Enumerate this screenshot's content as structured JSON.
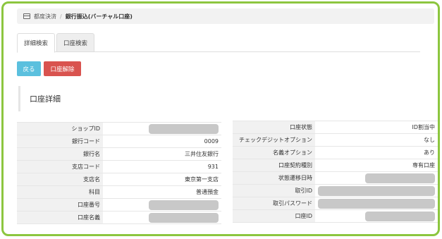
{
  "breadcrumb": {
    "parent": "都度決済",
    "separator": "/",
    "current": "銀行振込(バーチャル口座)"
  },
  "tabs": [
    {
      "label": "詳細検索",
      "active": true
    },
    {
      "label": "口座検索",
      "active": false
    }
  ],
  "buttons": {
    "back": "戻る",
    "release": "口座解除"
  },
  "section_title": "口座詳細",
  "left_rows": [
    {
      "label": "ショップID",
      "value": ""
    },
    {
      "label": "銀行コード",
      "value": "0009"
    },
    {
      "label": "銀行名",
      "value": "三井住友銀行"
    },
    {
      "label": "支店コード",
      "value": "931"
    },
    {
      "label": "支店名",
      "value": "東京第一支店"
    },
    {
      "label": "科目",
      "value": "普通預金"
    },
    {
      "label": "口座番号",
      "value": ""
    },
    {
      "label": "口座名義",
      "value": ""
    }
  ],
  "right_rows": [
    {
      "label": "口座状態",
      "value": "ID割当中"
    },
    {
      "label": "チェックデジットオプション",
      "value": "なし"
    },
    {
      "label": "名義オプション",
      "value": "あり"
    },
    {
      "label": "口座契約種別",
      "value": "専有口座"
    },
    {
      "label": "状態遷移日時",
      "value": ""
    },
    {
      "label": "取引ID",
      "value": ""
    },
    {
      "label": "取引パスワード",
      "value": ""
    },
    {
      "label": "口座ID",
      "value": ""
    }
  ],
  "colors": {
    "frame": "#8cc63f",
    "back_button": "#5bc0de",
    "release_button": "#d9534f",
    "masked_value": "#c8c8c8"
  }
}
